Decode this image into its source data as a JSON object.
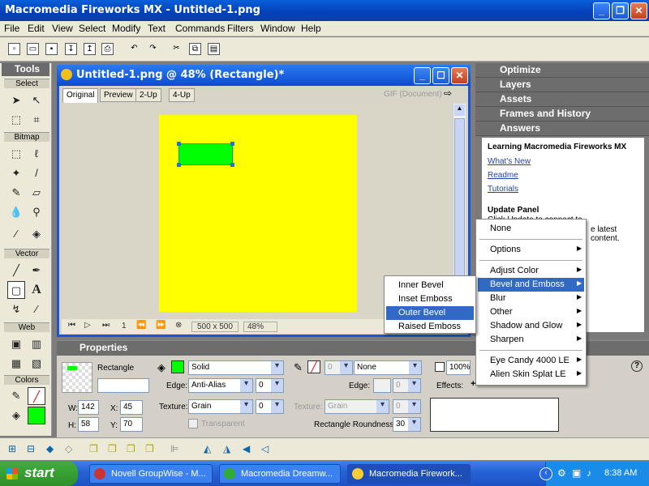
{
  "titlebar": {
    "title": "Macromedia Fireworks MX - Untitled-1.png"
  },
  "menu": [
    "File",
    "Edit",
    "View",
    "Select",
    "Modify",
    "Text",
    "Commands",
    "Filters",
    "Window",
    "Help"
  ],
  "tools": {
    "title": "Tools",
    "sections": [
      "Select",
      "Bitmap",
      "Vector",
      "Web",
      "Colors"
    ]
  },
  "document": {
    "title": "Untitled-1.png @  48% (Rectangle)*",
    "tabs": [
      "Original",
      "Preview",
      "2-Up",
      "4-Up"
    ],
    "format_label": "GIF (Document)",
    "page_num": "1",
    "size": "500 x 500",
    "zoom": "48%"
  },
  "panels": {
    "optimize": "Optimize",
    "layers": "Layers",
    "assets": "Assets",
    "frames": "Frames and History",
    "answers": "Answers",
    "answers_title": "Learning Macromedia Fireworks MX",
    "links": [
      "What's New",
      "Readme",
      "Tutorials"
    ],
    "update_title": "Update Panel",
    "update_text": "Click Update to connect to",
    "update_text2": "e latest content."
  },
  "properties": {
    "title": "Properties",
    "object_name": "Rectangle",
    "name_value": "",
    "fill_type": "Solid",
    "edge_label": "Edge:",
    "edge_value": "Anti-Alias",
    "edge_num": "0",
    "texture_label": "Texture:",
    "texture_value": "Grain",
    "texture_num": "0",
    "transparent": "Transparent",
    "stroke_num": "0",
    "stroke_type": "None",
    "edge2_label": "Edge:",
    "edge2_num": "0",
    "texture2_label": "Texture:",
    "texture2_value": "Grain",
    "texture2_num": "0",
    "roundness_label": "Rectangle Roundness:",
    "roundness_value": "30",
    "opacity": "100%",
    "effects_label": "Effects:",
    "w_label": "W:",
    "w": "142",
    "h_label": "H:",
    "h": "58",
    "x_label": "X:",
    "x": "45",
    "y_label": "Y:",
    "y": "70"
  },
  "effects_menu": {
    "items": [
      "None",
      "Options",
      "Adjust Color",
      "Bevel and Emboss",
      "Blur",
      "Other",
      "Shadow and Glow",
      "Sharpen",
      "Eye Candy 4000 LE",
      "Alien Skin Splat LE"
    ],
    "highlighted": "Bevel and Emboss"
  },
  "bevel_submenu": {
    "items": [
      "Inner Bevel",
      "Inset Emboss",
      "Outer Bevel",
      "Raised Emboss"
    ],
    "highlighted": "Outer Bevel"
  },
  "taskbar": {
    "start": "start",
    "tasks": [
      "Novell GroupWise - M...",
      "Macromedia Dreamw...",
      "Macromedia Firework..."
    ],
    "clock": "8:38 AM"
  },
  "colors": {
    "canvas": "#ffff00",
    "rectangle": "#00ff00",
    "highlight": "#316ac5"
  }
}
